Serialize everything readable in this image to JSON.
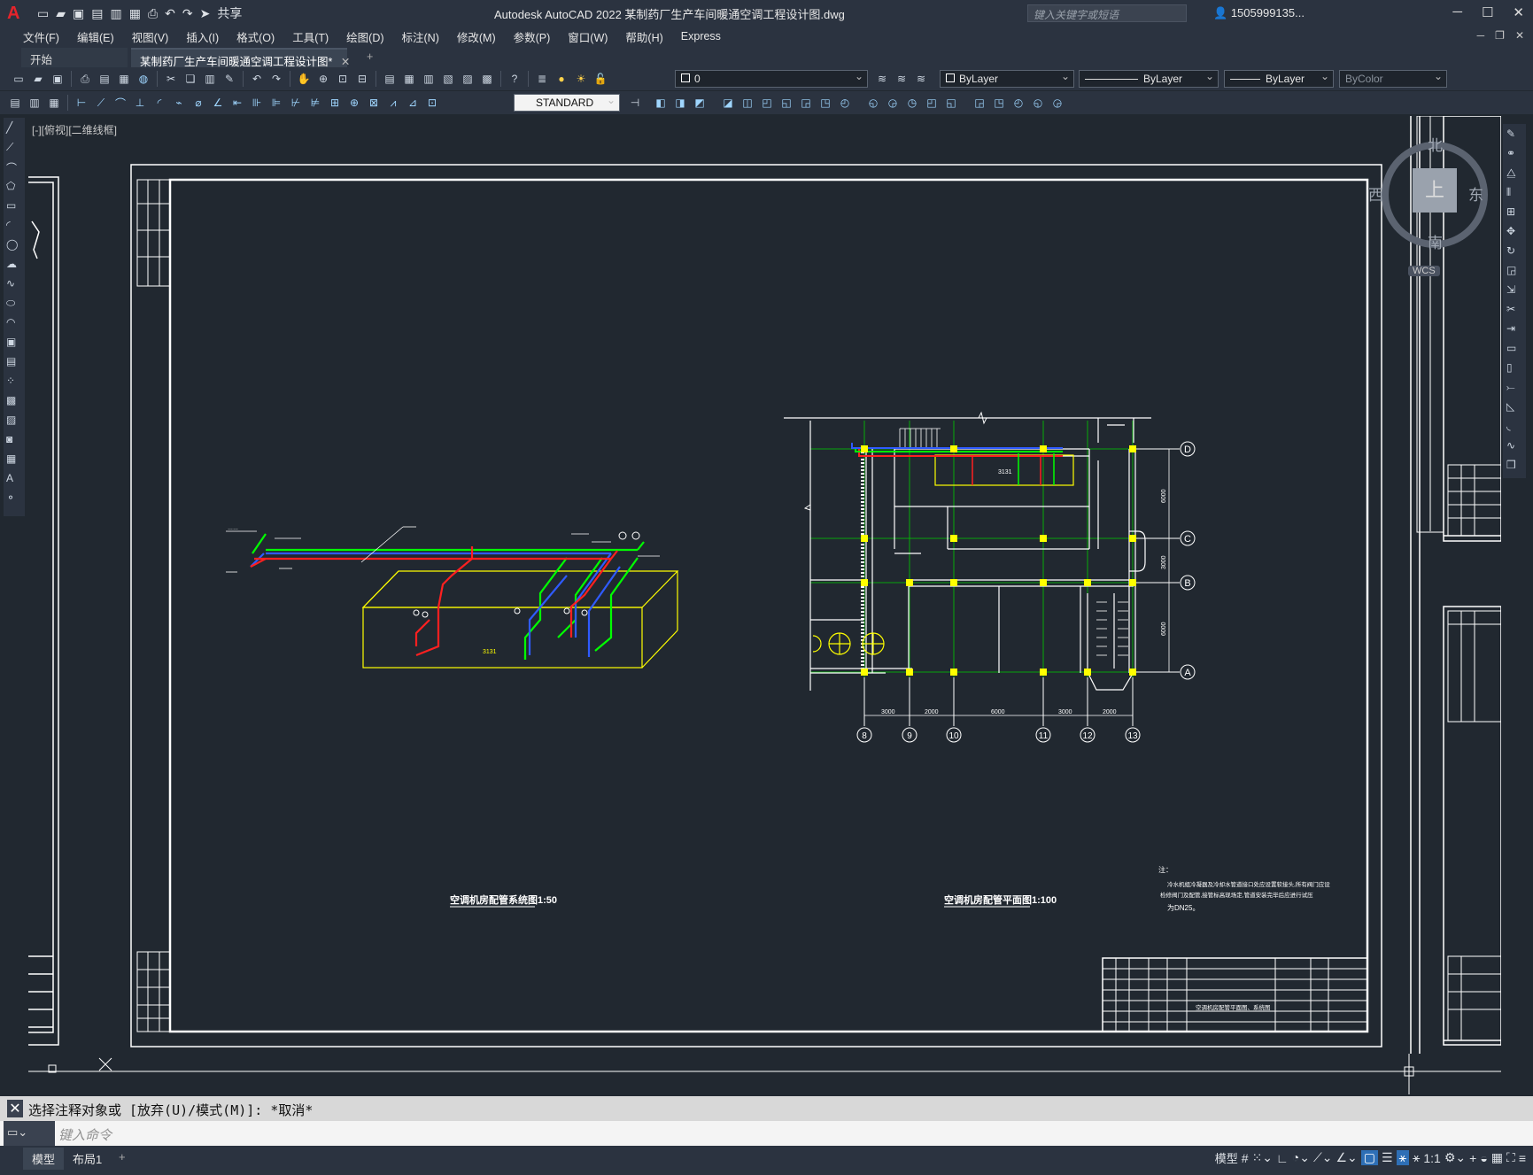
{
  "app": {
    "window_title": "Autodesk AutoCAD 2022    某制药厂生产车间暖通空调工程设计图.dwg",
    "share_label": "共享",
    "search_placeholder": "键入关键字或短语",
    "user": "1505999135..."
  },
  "menu": [
    "文件(F)",
    "编辑(E)",
    "视图(V)",
    "插入(I)",
    "格式(O)",
    "工具(T)",
    "绘图(D)",
    "标注(N)",
    "修改(M)",
    "参数(P)",
    "窗口(W)",
    "帮助(H)",
    "Express"
  ],
  "tabs": {
    "start": "开始",
    "active": "某制药厂生产车间暖通空调工程设计图*",
    "add": "+"
  },
  "toolbar": {
    "layer_value": "0",
    "color_value": "ByLayer",
    "linetype_value": "ByLayer",
    "lineweight_value": "ByLayer",
    "plotstyle_value": "ByColor",
    "text_style": "STANDARD"
  },
  "viewport": {
    "label": "[-][俯视][二维线框]"
  },
  "viewcube": {
    "north": "北",
    "south": "南",
    "east": "东",
    "west": "西",
    "top": "上",
    "wcs": "WCS"
  },
  "drawing": {
    "system_title": "空调机房配管系统图1:50",
    "plan_title": "空调机房配管平面图1:100",
    "grid_right": [
      "D",
      "C",
      "B",
      "A"
    ],
    "grid_bottom": [
      "8",
      "9",
      "10",
      "11",
      "12",
      "13"
    ],
    "dims_bottom": [
      "3000",
      "2000",
      "6000",
      "3000",
      "2000"
    ],
    "dims_right": [
      "6000",
      "3000",
      "6000"
    ],
    "notes_head": "注：",
    "notes_lines": [
      "冷水机组冷凝器及冷却水管道接口处应设置软接头,所有阀门应设",
      "检修阀门及配管,接管标高现场定,管道安装完毕后应进行试压",
      "为DN25。"
    ],
    "title_block_name": "空调机房配管平面图、系统图",
    "zh_eq": "3131"
  },
  "command": {
    "history": "选择注释对象或 [放弃(U)/模式(M)]: *取消*",
    "placeholder": "键入命令"
  },
  "status": {
    "model_tab": "模型",
    "layout_tab": "布局1",
    "model_label": "模型",
    "scale": "1:1"
  }
}
